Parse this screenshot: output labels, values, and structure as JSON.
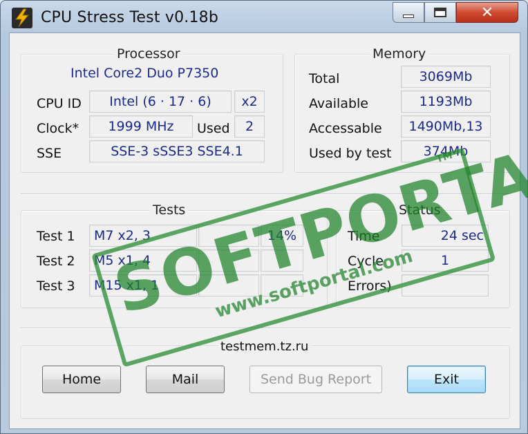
{
  "window": {
    "title": "CPU Stress Test  v0.18b",
    "close_glyph": "✕"
  },
  "processor": {
    "group_title": "Processor",
    "name": "Intel Core2 Duo  P7350",
    "cpu_id_label": "CPU ID",
    "cpu_id_value": "Intel  (6 · 17 · 6)",
    "cores": "x2",
    "clock_label": "Clock*",
    "clock_value": "1999 MHz",
    "used_label": "Used",
    "used_value": "2",
    "sse_label": "SSE",
    "sse_value": "SSE-3 sSSE3 SSE4.1"
  },
  "memory": {
    "group_title": "Memory",
    "total_label": "Total",
    "total_value": "3069Mb",
    "available_label": "Available",
    "available_value": "1193Mb",
    "accessable_label": "Accessable",
    "accessable_value": "1490Mb,13",
    "used_by_test_label": "Used by test",
    "used_by_test_value": "374Mb"
  },
  "tests": {
    "group_title": "Tests",
    "rows": [
      {
        "label": "Test  1",
        "value": "M7 x2, 3",
        "extra": "",
        "percent": "14%"
      },
      {
        "label": "Test  2",
        "value": "M5 x1, 4",
        "extra": "",
        "percent": ""
      },
      {
        "label": "Test  3",
        "value": "M15 x1, 1",
        "extra": "",
        "percent": ""
      }
    ]
  },
  "status": {
    "group_title": "Status",
    "time_label": "Time",
    "time_value": "24 sec",
    "cycle_label": "Cycle",
    "cycle_value": "1",
    "errors_label": "Errors)",
    "errors_value": ""
  },
  "footer": {
    "link": "testmem.tz.ru",
    "home_label": "Home",
    "mail_label": "Mail",
    "bug_label": "Send Bug Report",
    "exit_label": "Exit"
  },
  "watermark": {
    "text": "SOFTPORTAL",
    "url": "www.softportal.com",
    "tm": "TM"
  },
  "colors": {
    "value_text": "#1c2a90",
    "watermark": "#1e8228"
  }
}
